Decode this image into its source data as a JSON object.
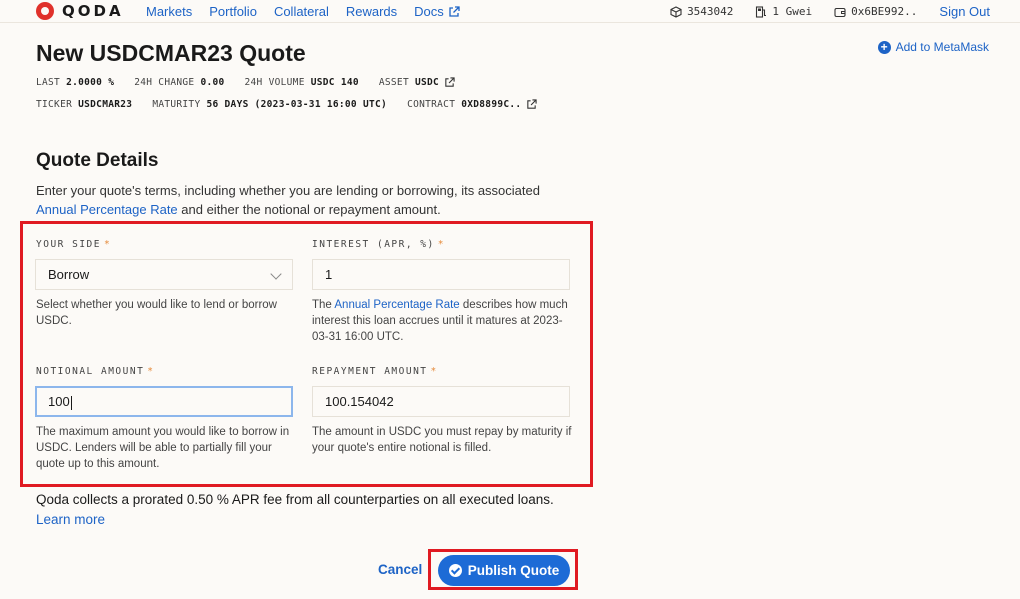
{
  "nav": {
    "logo_text": "QODA",
    "links": [
      "Markets",
      "Portfolio",
      "Collateral",
      "Rewards",
      "Docs"
    ],
    "block": "3543042",
    "gas": "1 Gwei",
    "wallet": "0x6BE992..",
    "signout": "Sign Out"
  },
  "header": {
    "title": "New USDCMAR23 Quote",
    "add_metamask": "Add to MetaMask",
    "stats1": [
      {
        "label": "LAST",
        "value": "2.0000 %"
      },
      {
        "label": "24H CHANGE",
        "value": "0.00"
      },
      {
        "label": "24H VOLUME",
        "value": "USDC 140"
      },
      {
        "label": "ASSET",
        "value": "USDC"
      }
    ],
    "stats2": [
      {
        "label": "TICKER",
        "value": "USDCMAR23"
      },
      {
        "label": "MATURITY",
        "value": "56 DAYS (2023-03-31 16:00 UTC)"
      },
      {
        "label": "CONTRACT",
        "value": "0XD8899C.."
      }
    ]
  },
  "details": {
    "heading": "Quote Details",
    "intro_1": "Enter your quote's terms, including whether you are lending or borrowing, its associated",
    "intro_link": "Annual Percentage Rate",
    "intro_2": " and either the notional or repayment amount.",
    "side": {
      "label": "YOUR SIDE",
      "value": "Borrow",
      "help": "Select whether you would like to lend or borrow USDC."
    },
    "interest": {
      "label": "INTEREST (APR, %)",
      "value": "1",
      "help_pre": "The ",
      "help_link": "Annual Percentage Rate",
      "help_post": " describes how much interest this loan accrues until it matures at 2023-03-31 16:00 UTC."
    },
    "notional": {
      "label": "NOTIONAL AMOUNT",
      "value": "100",
      "help": "The maximum amount you would like to borrow in USDC. Lenders will be able to partially fill your quote up to this amount."
    },
    "repayment": {
      "label": "REPAYMENT AMOUNT",
      "value": "100.154042",
      "help": "The amount in USDC you must repay by maturity if your quote's entire notional is filled."
    },
    "required_mark": "*",
    "fee_note": "Qoda collects a prorated 0.50 % APR fee from all counterparties on all executed loans.",
    "learn_more": "Learn more"
  },
  "actions": {
    "cancel": "Cancel",
    "publish": "Publish Quote"
  },
  "colors": {
    "accent": "#1d63c6",
    "highlight": "#e01a22",
    "brand": "#e0312b"
  }
}
